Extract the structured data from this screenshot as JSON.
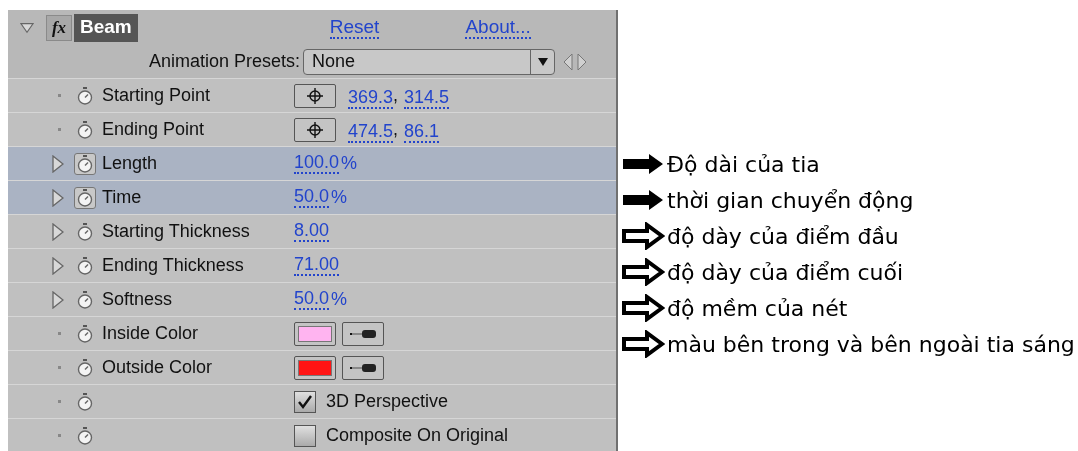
{
  "effect": {
    "badge": "fx",
    "name": "Beam",
    "expanded": true,
    "reset": "Reset",
    "about": "About..."
  },
  "presets": {
    "label": "Animation Presets:",
    "value": "None"
  },
  "properties": [
    {
      "kind": "point",
      "label": "Starting Point",
      "values": [
        "369.3",
        "314.5"
      ],
      "separator": ",",
      "expandable": false,
      "selected": false
    },
    {
      "kind": "point",
      "label": "Ending Point",
      "values": [
        "474.5",
        "86.1"
      ],
      "separator": ",",
      "expandable": false,
      "selected": false
    },
    {
      "kind": "value",
      "label": "Length",
      "value": "100.0",
      "unit": "%",
      "expandable": true,
      "selected": true
    },
    {
      "kind": "value",
      "label": "Time",
      "value": "50.0",
      "unit": "%",
      "expandable": true,
      "selected": true
    },
    {
      "kind": "value",
      "label": "Starting Thickness",
      "value": "8.00",
      "expandable": true,
      "selected": false
    },
    {
      "kind": "value",
      "label": "Ending Thickness",
      "value": "71.00",
      "expandable": true,
      "selected": false
    },
    {
      "kind": "value",
      "label": "Softness",
      "value": "50.0",
      "unit": "%",
      "expandable": true,
      "selected": false
    },
    {
      "kind": "color",
      "label": "Inside Color",
      "color": "#ffb4f0",
      "expandable": false,
      "selected": false
    },
    {
      "kind": "color",
      "label": "Outside Color",
      "color": "#ff1414",
      "expandable": false,
      "selected": false
    },
    {
      "kind": "checkbox",
      "option": "3D Perspective",
      "checked": true,
      "expandable": false,
      "selected": false
    },
    {
      "kind": "checkbox",
      "option": "Composite On Original",
      "checked": false,
      "expandable": false,
      "selected": false
    }
  ],
  "annotations": [
    {
      "kind": "filled",
      "text": "Độ dài của tia"
    },
    {
      "kind": "filled",
      "text": "thời gian chuyển động"
    },
    {
      "kind": "outline",
      "text": "độ dày của điểm đầu"
    },
    {
      "kind": "outline",
      "text": "độ dày của điểm cuối"
    },
    {
      "kind": "outline",
      "text": "độ mềm của nét"
    },
    {
      "kind": "outline",
      "text": "màu bên trong và bên ngoài tia sáng"
    }
  ]
}
